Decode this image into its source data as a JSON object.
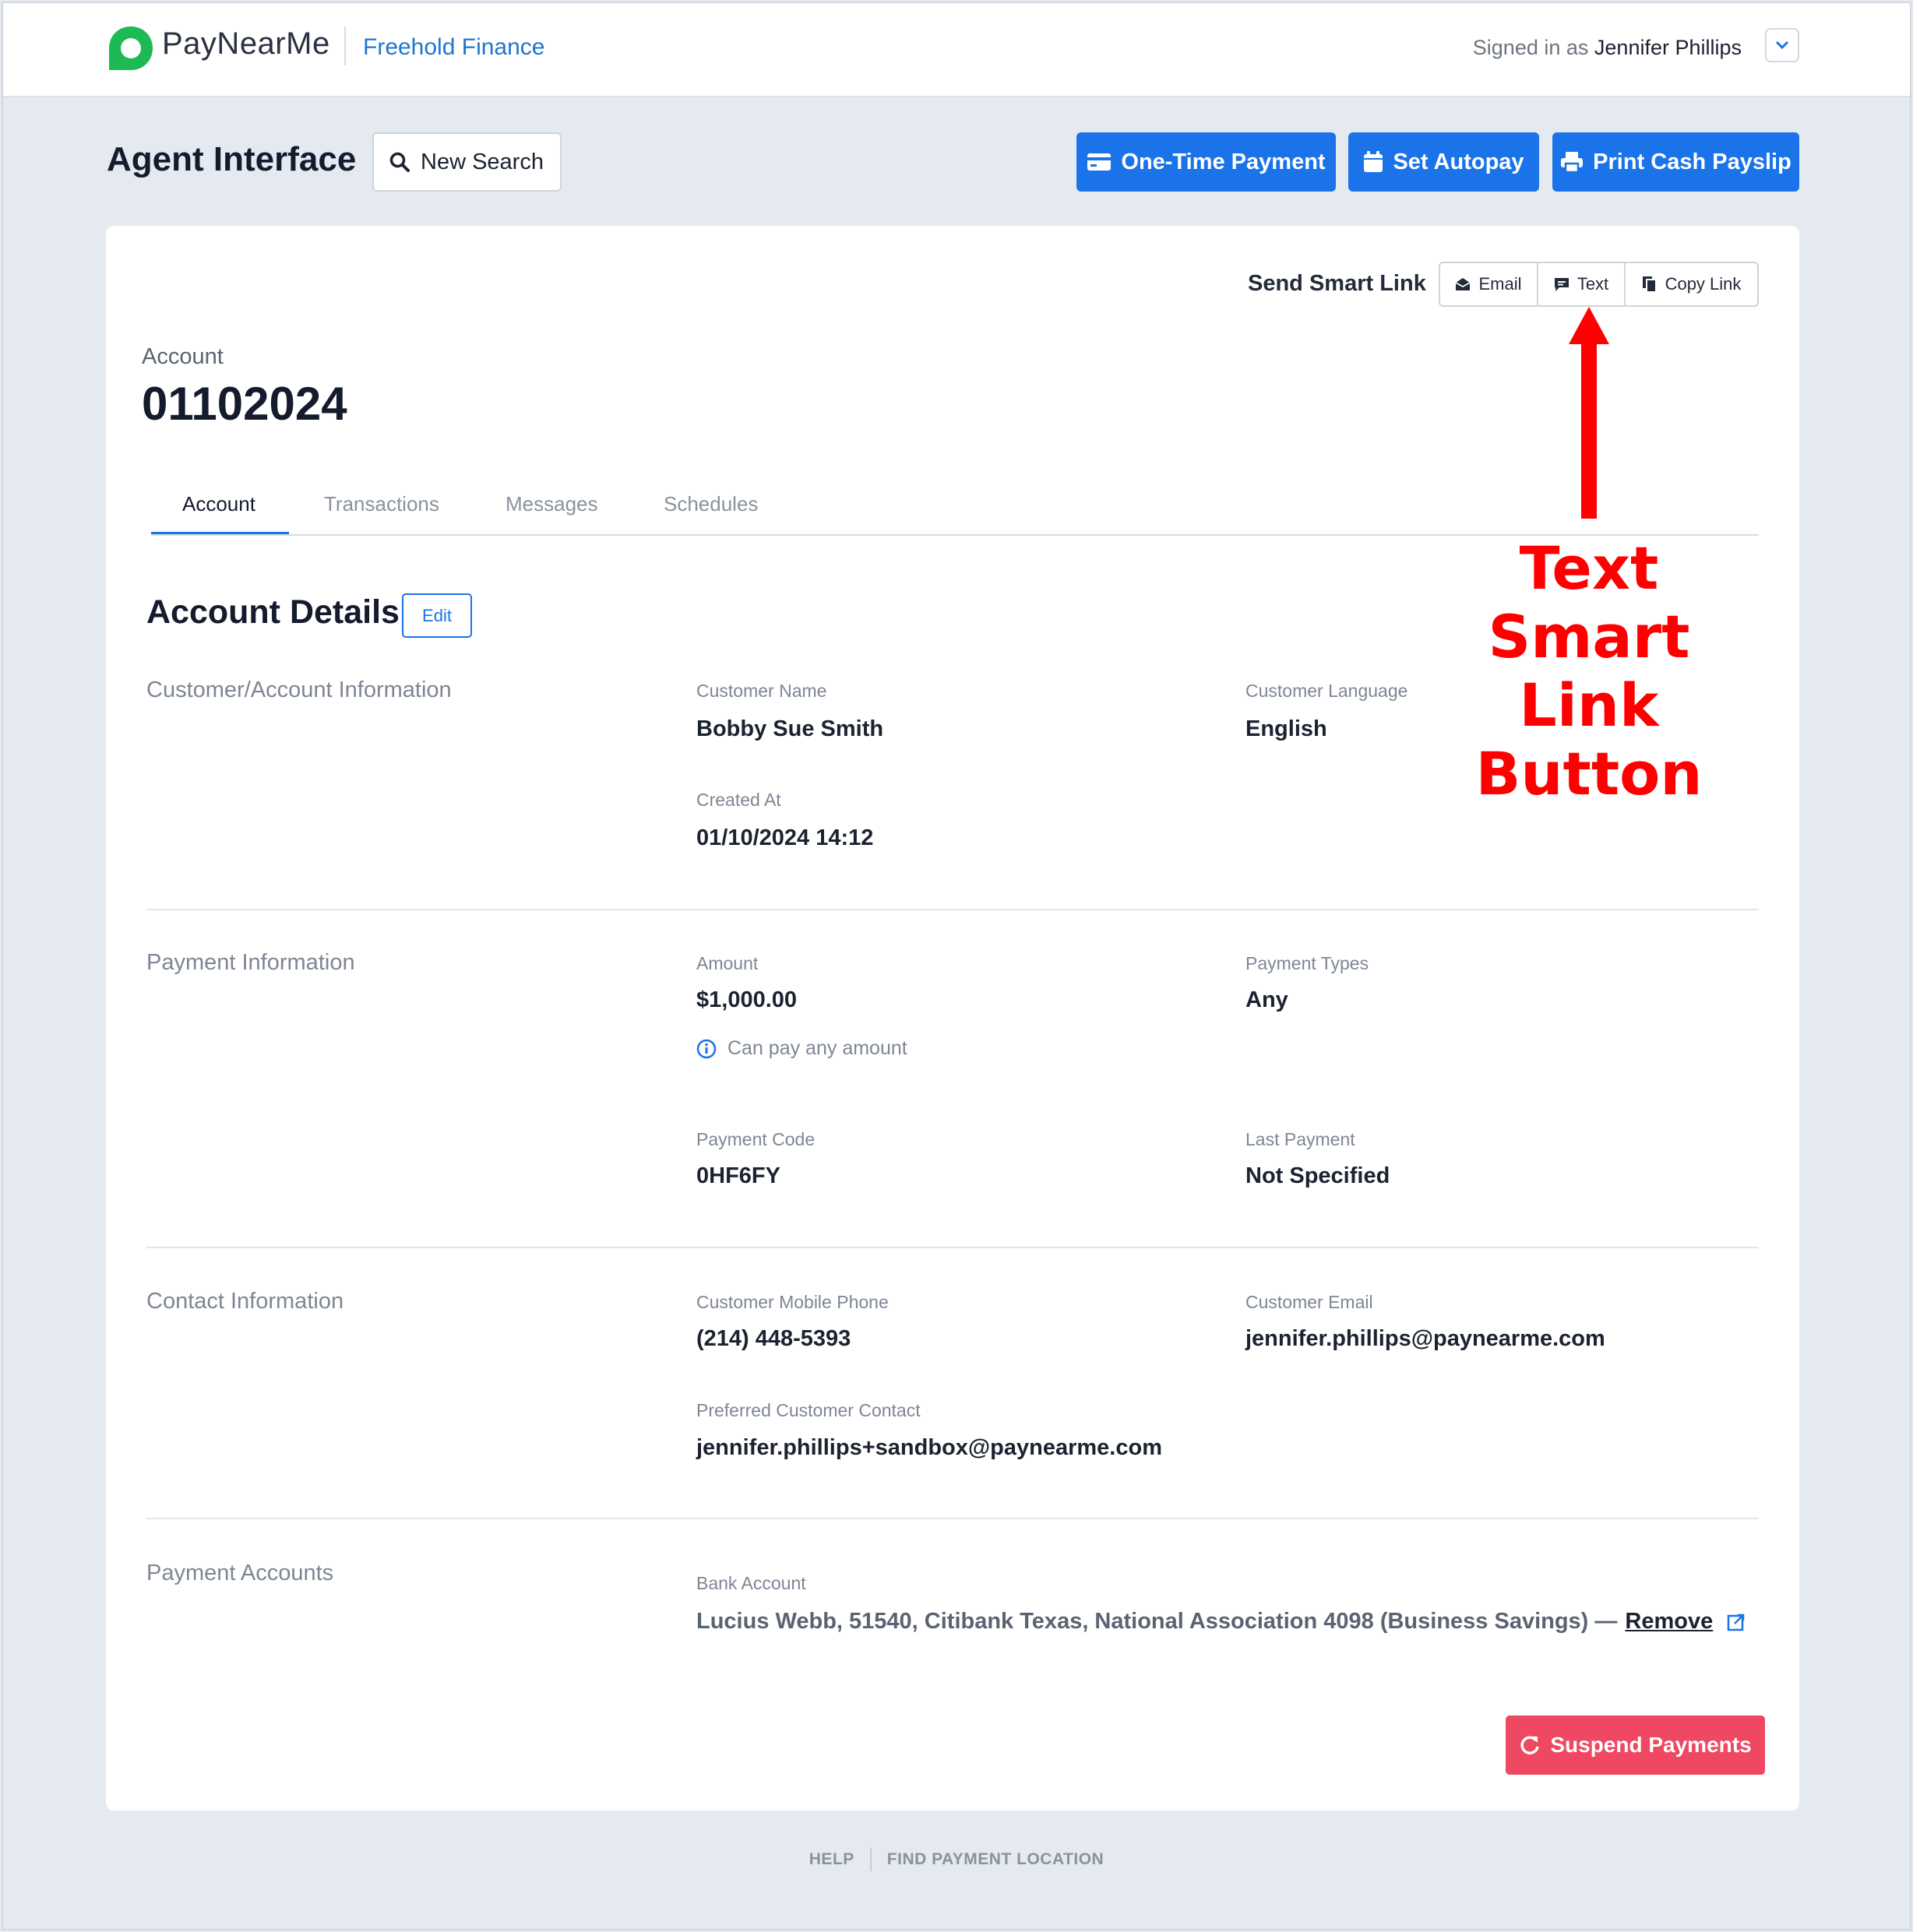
{
  "topbar": {
    "brand": "PayNearMe",
    "org": "Freehold Finance",
    "signed_in_prefix": "Signed in as",
    "user": "Jennifer Phillips"
  },
  "header": {
    "title": "Agent Interface",
    "new_search": "New Search",
    "one_time_payment": "One-Time Payment",
    "set_autopay": "Set Autopay",
    "print_cash_payslip": "Print Cash Payslip"
  },
  "smart_link": {
    "label": "Send Smart Link",
    "email": "Email",
    "text": "Text",
    "copy_link": "Copy Link"
  },
  "account": {
    "label": "Account",
    "number": "01102024"
  },
  "tabs": [
    "Account",
    "Transactions",
    "Messages",
    "Schedules"
  ],
  "details": {
    "title": "Account Details",
    "edit": "Edit",
    "customer_info": {
      "title": "Customer/Account Information",
      "customer_name_label": "Customer Name",
      "customer_name": "Bobby Sue Smith",
      "customer_language_label": "Customer Language",
      "customer_language": "English",
      "created_at_label": "Created At",
      "created_at": "01/10/2024 14:12"
    },
    "payment_info": {
      "title": "Payment Information",
      "amount_label": "Amount",
      "amount": "$1,000.00",
      "amount_note": "Can pay any amount",
      "payment_types_label": "Payment Types",
      "payment_types": "Any",
      "payment_code_label": "Payment Code",
      "payment_code": "0HF6FY",
      "last_payment_label": "Last Payment",
      "last_payment": "Not Specified"
    },
    "contact_info": {
      "title": "Contact Information",
      "mobile_label": "Customer Mobile Phone",
      "mobile": "(214) 448-5393",
      "email_label": "Customer Email",
      "email": "jennifer.phillips@paynearme.com",
      "preferred_label": "Preferred Customer Contact",
      "preferred": "jennifer.phillips+sandbox@paynearme.com"
    },
    "payment_accounts": {
      "title": "Payment Accounts",
      "bank_label": "Bank Account",
      "bank_value": "Lucius Webb, 51540, Citibank Texas, National Association 4098 (Business Savings) —",
      "remove": "Remove"
    },
    "suspend": "Suspend Payments"
  },
  "footer": {
    "help": "HELP",
    "find_location": "FIND PAYMENT LOCATION"
  },
  "annotation": {
    "line1": "Text Smart",
    "line2": "Link Button"
  },
  "colors": {
    "primary": "#1a73e8",
    "danger": "#ee4863",
    "brand_green": "#1db954",
    "annotation": "#ff0000",
    "background": "#e5e9f0"
  }
}
